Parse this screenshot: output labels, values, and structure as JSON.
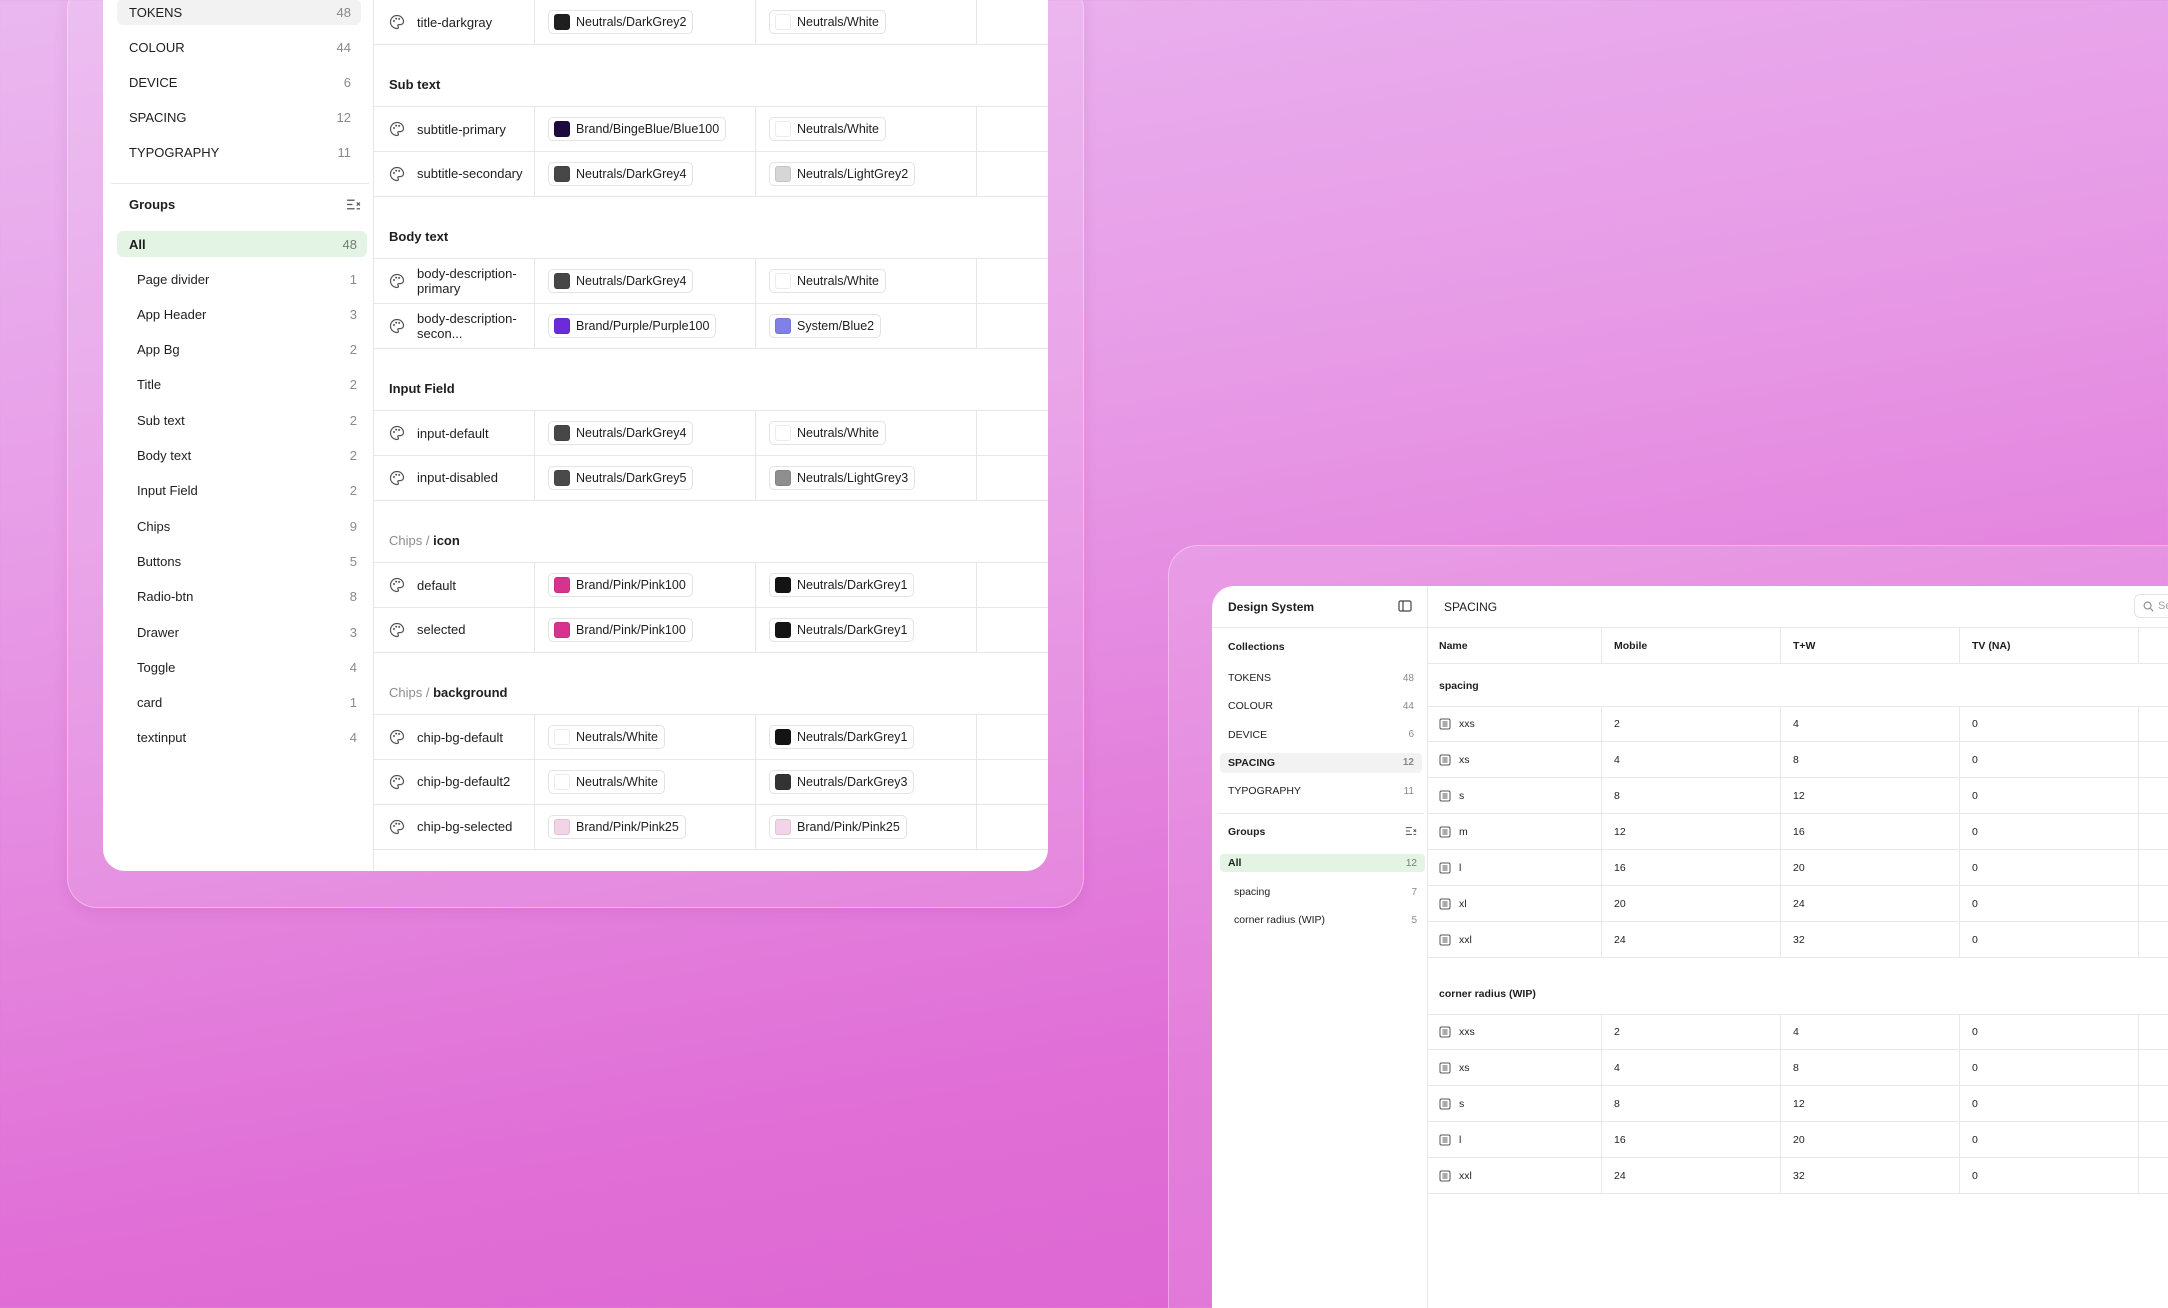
{
  "left_window": {
    "collections": [
      {
        "label": "TOKENS",
        "count": "48",
        "active": true
      },
      {
        "label": "COLOUR",
        "count": "44"
      },
      {
        "label": "DEVICE",
        "count": "6"
      },
      {
        "label": "SPACING",
        "count": "12"
      },
      {
        "label": "TYPOGRAPHY",
        "count": "11"
      }
    ],
    "groups_title": "Groups",
    "all": {
      "label": "All",
      "count": "48"
    },
    "groups": [
      {
        "label": "Page divider",
        "count": "1"
      },
      {
        "label": "App Header",
        "count": "3"
      },
      {
        "label": "App Bg",
        "count": "2"
      },
      {
        "label": "Title",
        "count": "2"
      },
      {
        "label": "Sub text",
        "count": "2"
      },
      {
        "label": "Body text",
        "count": "2"
      },
      {
        "label": "Input Field",
        "count": "2"
      },
      {
        "label": "Chips",
        "count": "9"
      },
      {
        "label": "Buttons",
        "count": "5"
      },
      {
        "label": "Radio-btn",
        "count": "8"
      },
      {
        "label": "Drawer",
        "count": "3"
      },
      {
        "label": "Toggle",
        "count": "4"
      },
      {
        "label": "card",
        "count": "1"
      },
      {
        "label": "textinput",
        "count": "4"
      }
    ],
    "sections": [
      {
        "prefix": "",
        "title": "",
        "rows": [
          {
            "name": "title-darkgray",
            "c1": "Neutrals/DarkGrey2",
            "c1color": "#1f1f1f",
            "c2": "Neutrals/White",
            "c2color": "#ffffff"
          }
        ]
      },
      {
        "prefix": "",
        "title": "Sub text",
        "rows": [
          {
            "name": "subtitle-primary",
            "c1": "Brand/BingeBlue/Blue100",
            "c1color": "#1d0b3f",
            "c2": "Neutrals/White",
            "c2color": "#ffffff"
          },
          {
            "name": "subtitle-secondary",
            "c1": "Neutrals/DarkGrey4",
            "c1color": "#474747",
            "c2": "Neutrals/LightGrey2",
            "c2color": "#d6d6d6"
          }
        ]
      },
      {
        "prefix": "",
        "title": "Body text",
        "rows": [
          {
            "name": "body-description-primary",
            "c1": "Neutrals/DarkGrey4",
            "c1color": "#474747",
            "c2": "Neutrals/White",
            "c2color": "#ffffff"
          },
          {
            "name": "body-description-secon...",
            "c1": "Brand/Purple/Purple100",
            "c1color": "#6b2bd9",
            "c2": "System/Blue2",
            "c2color": "#7f80e8"
          }
        ]
      },
      {
        "prefix": "",
        "title": "Input Field",
        "rows": [
          {
            "name": "input-default",
            "c1": "Neutrals/DarkGrey4",
            "c1color": "#474747",
            "c2": "Neutrals/White",
            "c2color": "#ffffff"
          },
          {
            "name": "input-disabled",
            "c1": "Neutrals/DarkGrey5",
            "c1color": "#4a4a4a",
            "c2": "Neutrals/LightGrey3",
            "c2color": "#8f8f8f"
          }
        ]
      },
      {
        "prefix": "Chips /",
        "title": "icon",
        "rows": [
          {
            "name": "default",
            "c1": "Brand/Pink/Pink100",
            "c1color": "#d8328f",
            "c2": "Neutrals/DarkGrey1",
            "c2color": "#141414"
          },
          {
            "name": "selected",
            "c1": "Brand/Pink/Pink100",
            "c1color": "#d8328f",
            "c2": "Neutrals/DarkGrey1",
            "c2color": "#141414"
          }
        ]
      },
      {
        "prefix": "Chips /",
        "title": "background",
        "rows": [
          {
            "name": "chip-bg-default",
            "c1": "Neutrals/White",
            "c1color": "#ffffff",
            "c2": "Neutrals/DarkGrey1",
            "c2color": "#141414"
          },
          {
            "name": "chip-bg-default2",
            "c1": "Neutrals/White",
            "c1color": "#ffffff",
            "c2": "Neutrals/DarkGrey3",
            "c2color": "#333333"
          },
          {
            "name": "chip-bg-selected",
            "c1": "Brand/Pink/Pink25",
            "c1color": "#f3d3e8",
            "c2": "Brand/Pink/Pink25",
            "c2color": "#f3d3e8"
          }
        ]
      }
    ]
  },
  "right_window": {
    "app_title": "Design System",
    "page_title": "SPACING",
    "search_placeholder": "Se",
    "collections_title": "Collections",
    "collections": [
      {
        "label": "TOKENS",
        "count": "48"
      },
      {
        "label": "COLOUR",
        "count": "44"
      },
      {
        "label": "DEVICE",
        "count": "6"
      },
      {
        "label": "SPACING",
        "count": "12",
        "active": true
      },
      {
        "label": "TYPOGRAPHY",
        "count": "11"
      }
    ],
    "groups_title": "Groups",
    "all": {
      "label": "All",
      "count": "12"
    },
    "groups": [
      {
        "label": "spacing",
        "count": "7"
      },
      {
        "label": "corner radius (WIP)",
        "count": "5"
      }
    ],
    "columns": [
      "Name",
      "Mobile",
      "T+W",
      "TV (NA)"
    ],
    "sections": [
      {
        "title": "spacing",
        "rows": [
          {
            "name": "xxs",
            "mobile": "2",
            "tw": "4",
            "tv": "0"
          },
          {
            "name": "xs",
            "mobile": "4",
            "tw": "8",
            "tv": "0"
          },
          {
            "name": "s",
            "mobile": "8",
            "tw": "12",
            "tv": "0"
          },
          {
            "name": "m",
            "mobile": "12",
            "tw": "16",
            "tv": "0"
          },
          {
            "name": "l",
            "mobile": "16",
            "tw": "20",
            "tv": "0"
          },
          {
            "name": "xl",
            "mobile": "20",
            "tw": "24",
            "tv": "0"
          },
          {
            "name": "xxl",
            "mobile": "24",
            "tw": "32",
            "tv": "0"
          }
        ]
      },
      {
        "title": "corner radius (WIP)",
        "rows": [
          {
            "name": "xxs",
            "mobile": "2",
            "tw": "4",
            "tv": "0"
          },
          {
            "name": "xs",
            "mobile": "4",
            "tw": "8",
            "tv": "0"
          },
          {
            "name": "s",
            "mobile": "8",
            "tw": "12",
            "tv": "0"
          },
          {
            "name": "l",
            "mobile": "16",
            "tw": "20",
            "tv": "0"
          },
          {
            "name": "xxl",
            "mobile": "24",
            "tw": "32",
            "tv": "0"
          }
        ]
      }
    ]
  }
}
